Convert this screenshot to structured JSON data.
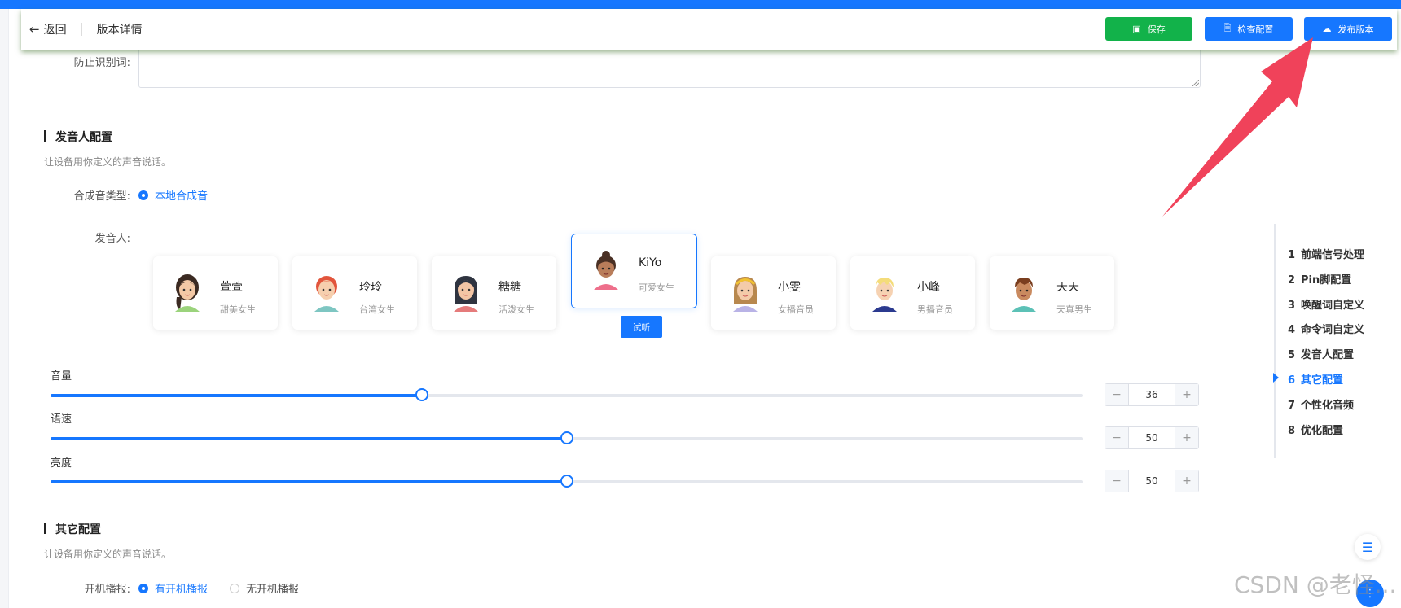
{
  "header": {
    "back_label": "返回",
    "title": "版本详情",
    "save_label": "保存",
    "check_label": "检查配置",
    "publish_label": "发布版本"
  },
  "anti_wake": {
    "label": "防止识别词:",
    "value": ""
  },
  "speaker_section": {
    "title": "发音人配置",
    "desc": "让设备用你定义的声音说话。",
    "synth_type_label": "合成音类型:",
    "synth_type_value": "本地合成音",
    "speaker_label": "发音人:",
    "listen_label": "试听",
    "speakers": [
      {
        "name": "萱萱",
        "desc": "甜美女生"
      },
      {
        "name": "玲玲",
        "desc": "台湾女生"
      },
      {
        "name": "糖糖",
        "desc": "活泼女生"
      },
      {
        "name": "KiYo",
        "desc": "可爱女生"
      },
      {
        "name": "小雯",
        "desc": "女播音员"
      },
      {
        "name": "小峰",
        "desc": "男播音员"
      },
      {
        "name": "天天",
        "desc": "天真男生"
      }
    ],
    "selected_speaker": "KiYo"
  },
  "sliders": [
    {
      "label": "音量",
      "value": "36",
      "percent": 36
    },
    {
      "label": "语速",
      "value": "50",
      "percent": 50
    },
    {
      "label": "亮度",
      "value": "50",
      "percent": 50
    }
  ],
  "other_section": {
    "title": "其它配置",
    "desc": "让设备用你定义的声音说话。",
    "boot_label": "开机播报:",
    "boot_on": "有开机播报",
    "boot_off": "无开机播报"
  },
  "toc": [
    {
      "num": "1",
      "label": "前端信号处理"
    },
    {
      "num": "2",
      "label": "Pin脚配置"
    },
    {
      "num": "3",
      "label": "唤醒词自定义"
    },
    {
      "num": "4",
      "label": "命令词自定义"
    },
    {
      "num": "5",
      "label": "发音人配置"
    },
    {
      "num": "6",
      "label": "其它配置"
    },
    {
      "num": "7",
      "label": "个性化音频"
    },
    {
      "num": "8",
      "label": "优化配置"
    }
  ],
  "toc_active": "其它配置",
  "watermark": "CSDN @老怪...",
  "colors": {
    "primary": "#1677ff",
    "save": "#12b24a",
    "arrow": "#f0425a"
  }
}
